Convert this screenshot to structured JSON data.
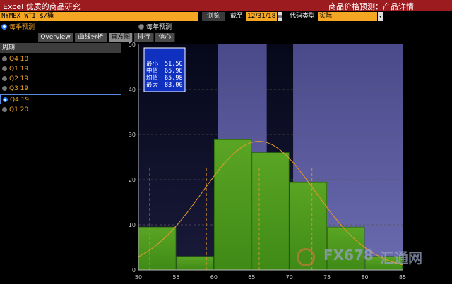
{
  "titlebar": {
    "left": "Excel  优质的商品研究",
    "right": "商品价格预测：产品详情"
  },
  "toolbar": {
    "ticker": "NYMEX WTI $/桶",
    "browse_label": "浏览",
    "cutoff_label": "截至",
    "cutoff_value": "12/31/18",
    "code_type_label": "代码类型",
    "code_type_value": "实际"
  },
  "mode": {
    "quarterly_label": "每季预测",
    "annual_label": "每年预测"
  },
  "tabs": [
    {
      "label": "Overview"
    },
    {
      "label": "曲线分析"
    },
    {
      "label": "直方图"
    },
    {
      "label": "排行"
    },
    {
      "label": "信心"
    }
  ],
  "sidebar": {
    "header": "周期",
    "items": [
      {
        "label": "Q4 18"
      },
      {
        "label": "Q1 19"
      },
      {
        "label": "Q2 19"
      },
      {
        "label": "Q3 19"
      },
      {
        "label": "Q4 19"
      },
      {
        "label": "Q1 20"
      }
    ]
  },
  "stats": {
    "min_label": "最小",
    "min_value": "51.50",
    "median_label": "中值",
    "median_value": "65.98",
    "mean_label": "均值",
    "mean_value": "65.98",
    "max_label": "最大",
    "max_value": "83.00"
  },
  "watermark": {
    "text": "FX678",
    "text2": "汇通网"
  },
  "colors": {
    "title_bg": "#9b1b1f",
    "accent_orange": "#f5a623",
    "bar_green": "#4f9a1e",
    "band_purple": "#5a5aa0",
    "curve": "#e89a2a"
  },
  "chart_data": {
    "type": "bar",
    "x_ticks": [
      50,
      55,
      60,
      65,
      70,
      75,
      80,
      85
    ],
    "y_ticks": [
      0,
      10,
      20,
      30,
      40,
      50
    ],
    "xlim": [
      50,
      85
    ],
    "ylim": [
      0,
      50
    ],
    "bins": [
      {
        "x0": 50,
        "x1": 55,
        "value": 9.5
      },
      {
        "x0": 55,
        "x1": 60,
        "value": 3
      },
      {
        "x0": 60,
        "x1": 65,
        "value": 29
      },
      {
        "x0": 65,
        "x1": 70,
        "value": 26
      },
      {
        "x0": 70,
        "x1": 75,
        "value": 19.5
      },
      {
        "x0": 75,
        "x1": 80,
        "value": 9.5
      },
      {
        "x0": 80,
        "x1": 85,
        "value": 3
      }
    ],
    "bands": [
      [
        60.5,
        67
      ],
      [
        70.5,
        85
      ]
    ],
    "reference_lines": [
      51.5,
      59,
      66,
      73
    ],
    "normal_curve": {
      "mean": 65.98,
      "sd": 7.5,
      "peak": 28.5
    },
    "grid": true
  }
}
